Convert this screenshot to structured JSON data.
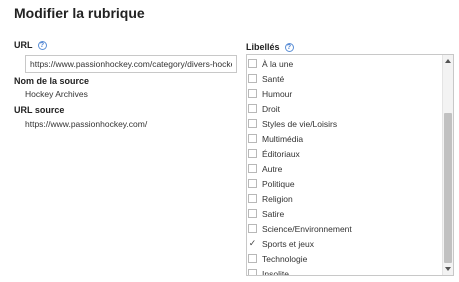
{
  "page": {
    "title": "Modifier la rubrique"
  },
  "url_field": {
    "label": "URL",
    "help_glyph": "?",
    "value": "https://www.passionhockey.com/category/divers-hockey/hockey-archives/"
  },
  "source_name": {
    "label": "Nom de la source",
    "value": "Hockey Archives"
  },
  "source_url": {
    "label": "URL source",
    "value": "https://www.passionhockey.com/"
  },
  "labels_panel": {
    "label": "Libellés",
    "help_glyph": "?",
    "items": [
      {
        "label": "À la une",
        "checked": false
      },
      {
        "label": "Santé",
        "checked": false
      },
      {
        "label": "Humour",
        "checked": false
      },
      {
        "label": "Droit",
        "checked": false
      },
      {
        "label": "Styles de vie/Loisirs",
        "checked": false
      },
      {
        "label": "Multimédia",
        "checked": false
      },
      {
        "label": "Éditoriaux",
        "checked": false
      },
      {
        "label": "Autre",
        "checked": false
      },
      {
        "label": "Politique",
        "checked": false
      },
      {
        "label": "Religion",
        "checked": false
      },
      {
        "label": "Satire",
        "checked": false
      },
      {
        "label": "Science/Environnement",
        "checked": false
      },
      {
        "label": "Sports et jeux",
        "checked": true
      },
      {
        "label": "Technologie",
        "checked": false
      },
      {
        "label": "Insolite",
        "checked": false
      }
    ]
  },
  "icons": {
    "checkmark": "check-icon",
    "scroll_up": "arrow-up-icon",
    "scroll_down": "arrow-down-icon"
  },
  "colors": {
    "help_icon": "#4a7fd0",
    "border": "#c8c8c8",
    "scroll_thumb": "#c1c1c1"
  }
}
